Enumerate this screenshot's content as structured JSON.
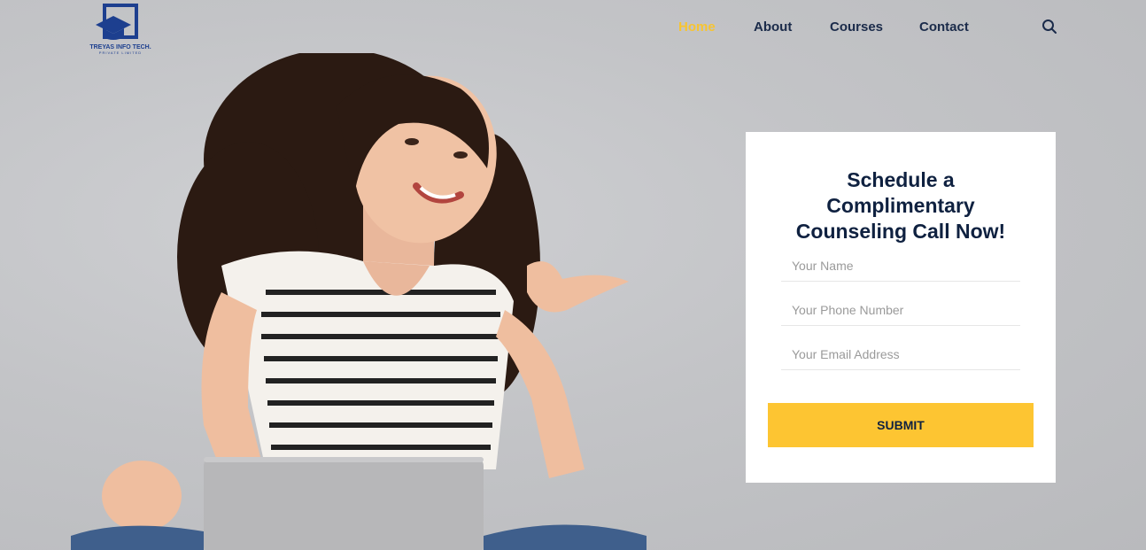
{
  "brand": {
    "name": "TREYAS INFO TECH.",
    "subtitle": "PRIVATE LIMITED",
    "logo_icon": "graduation-cap-square-icon",
    "color": "#1d3f8f"
  },
  "nav": {
    "items": [
      {
        "label": "Home",
        "active": true
      },
      {
        "label": "About",
        "active": false
      },
      {
        "label": "Courses",
        "active": false
      },
      {
        "label": "Contact",
        "active": false
      }
    ],
    "search_icon": "search-icon",
    "active_color": "#f7c431",
    "text_color": "#1b2b4a"
  },
  "form": {
    "title_line1": "Schedule a",
    "title_line2": "Complimentary",
    "title_line3": "Counseling Call Now!",
    "name_placeholder": "Your Name",
    "phone_placeholder": "Your Phone Number",
    "email_placeholder": "Your Email Address",
    "submit_label": "SUBMIT",
    "submit_color": "#fdc532"
  }
}
